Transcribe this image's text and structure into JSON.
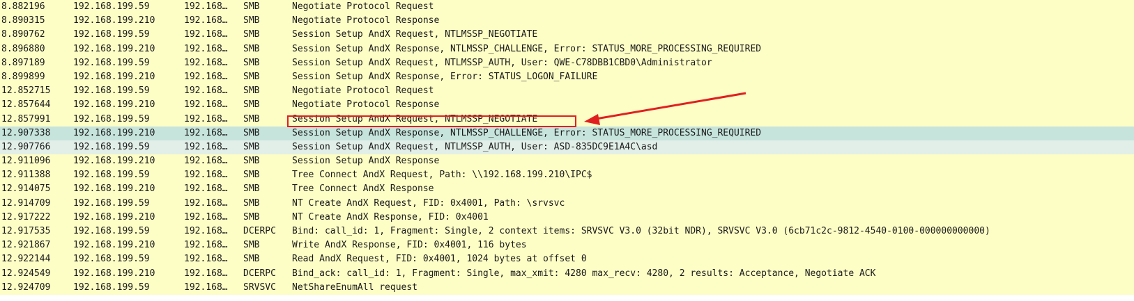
{
  "colors": {
    "default_row_bg": "#fdfdc6",
    "selected_row_bg": "#c6e4dc",
    "related_row_bg": "#e2efe8",
    "annotation": "#e02020"
  },
  "packets": [
    {
      "time": "8.882196",
      "source": "192.168.199.59",
      "destination": "192.168…",
      "protocol": "SMB",
      "info": "Negotiate Protocol Request",
      "state": "default"
    },
    {
      "time": "8.890315",
      "source": "192.168.199.210",
      "destination": "192.168…",
      "protocol": "SMB",
      "info": "Negotiate Protocol Response",
      "state": "default"
    },
    {
      "time": "8.890762",
      "source": "192.168.199.59",
      "destination": "192.168…",
      "protocol": "SMB",
      "info": "Session Setup AndX Request, NTLMSSP_NEGOTIATE",
      "state": "default"
    },
    {
      "time": "8.896880",
      "source": "192.168.199.210",
      "destination": "192.168…",
      "protocol": "SMB",
      "info": "Session Setup AndX Response, NTLMSSP_CHALLENGE, Error: STATUS_MORE_PROCESSING_REQUIRED",
      "state": "default"
    },
    {
      "time": "8.897189",
      "source": "192.168.199.59",
      "destination": "192.168…",
      "protocol": "SMB",
      "info": "Session Setup AndX Request, NTLMSSP_AUTH, User: QWE-C78DBB1CBD0\\Administrator",
      "state": "default"
    },
    {
      "time": "8.899899",
      "source": "192.168.199.210",
      "destination": "192.168…",
      "protocol": "SMB",
      "info": "Session Setup AndX Response, Error: STATUS_LOGON_FAILURE",
      "state": "default"
    },
    {
      "time": "12.852715",
      "source": "192.168.199.59",
      "destination": "192.168…",
      "protocol": "SMB",
      "info": "Negotiate Protocol Request",
      "state": "default"
    },
    {
      "time": "12.857644",
      "source": "192.168.199.210",
      "destination": "192.168…",
      "protocol": "SMB",
      "info": "Negotiate Protocol Response",
      "state": "default"
    },
    {
      "time": "12.857991",
      "source": "192.168.199.59",
      "destination": "192.168…",
      "protocol": "SMB",
      "info": "Session Setup AndX Request, NTLMSSP_NEGOTIATE",
      "state": "default"
    },
    {
      "time": "12.907338",
      "source": "192.168.199.210",
      "destination": "192.168…",
      "protocol": "SMB",
      "info": "Session Setup AndX Response, NTLMSSP_CHALLENGE, Error: STATUS_MORE_PROCESSING_REQUIRED",
      "state": "selected"
    },
    {
      "time": "12.907766",
      "source": "192.168.199.59",
      "destination": "192.168…",
      "protocol": "SMB",
      "info": "Session Setup AndX Request, NTLMSSP_AUTH, User: ASD-835DC9E1A4C\\asd",
      "state": "related"
    },
    {
      "time": "12.911096",
      "source": "192.168.199.210",
      "destination": "192.168…",
      "protocol": "SMB",
      "info": "Session Setup AndX Response",
      "state": "default"
    },
    {
      "time": "12.911388",
      "source": "192.168.199.59",
      "destination": "192.168…",
      "protocol": "SMB",
      "info": "Tree Connect AndX Request, Path: \\\\192.168.199.210\\IPC$",
      "state": "default"
    },
    {
      "time": "12.914075",
      "source": "192.168.199.210",
      "destination": "192.168…",
      "protocol": "SMB",
      "info": "Tree Connect AndX Response",
      "state": "default"
    },
    {
      "time": "12.914709",
      "source": "192.168.199.59",
      "destination": "192.168…",
      "protocol": "SMB",
      "info": "NT Create AndX Request, FID: 0x4001, Path: \\srvsvc",
      "state": "default"
    },
    {
      "time": "12.917222",
      "source": "192.168.199.210",
      "destination": "192.168…",
      "protocol": "SMB",
      "info": "NT Create AndX Response, FID: 0x4001",
      "state": "default"
    },
    {
      "time": "12.917535",
      "source": "192.168.199.59",
      "destination": "192.168…",
      "protocol": "DCERPC",
      "info": "Bind: call_id: 1, Fragment: Single, 2 context items: SRVSVC V3.0 (32bit NDR), SRVSVC V3.0 (6cb71c2c-9812-4540-0100-000000000000)",
      "state": "default"
    },
    {
      "time": "12.921867",
      "source": "192.168.199.210",
      "destination": "192.168…",
      "protocol": "SMB",
      "info": "Write AndX Response, FID: 0x4001, 116 bytes",
      "state": "default"
    },
    {
      "time": "12.922144",
      "source": "192.168.199.59",
      "destination": "192.168…",
      "protocol": "SMB",
      "info": "Read AndX Request, FID: 0x4001, 1024 bytes at offset 0",
      "state": "default"
    },
    {
      "time": "12.924549",
      "source": "192.168.199.210",
      "destination": "192.168…",
      "protocol": "DCERPC",
      "info": "Bind_ack: call_id: 1, Fragment: Single, max_xmit: 4280 max_recv: 4280, 2 results: Acceptance, Negotiate ACK",
      "state": "default"
    },
    {
      "time": "12.924709",
      "source": "192.168.199.59",
      "destination": "192.168…",
      "protocol": "SRVSVC",
      "info": "NetShareEnumAll request",
      "state": "default"
    }
  ]
}
